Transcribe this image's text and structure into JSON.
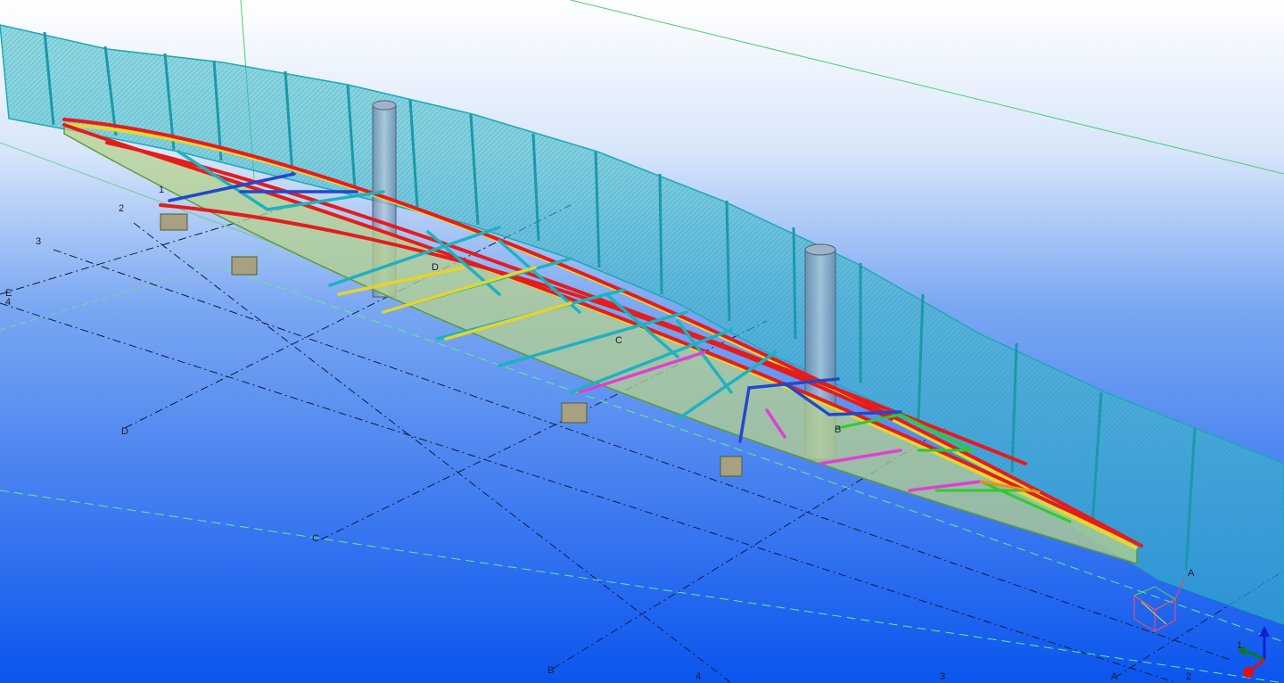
{
  "window": {
    "title": ""
  },
  "viewport": {
    "background": {
      "top": "#ffffff",
      "mid": "#5a8ff0",
      "bottom": "#0b55ee"
    },
    "colors": {
      "fence": "#29b8c8",
      "fence_fill": "#3cc2cc",
      "chord_red": "#e82020",
      "chord_yellow": "#e8d820",
      "member_teal": "#20b0c0",
      "member_blue": "#2050d0",
      "member_green": "#30d030",
      "member_magenta": "#e040d0",
      "deck_green": "#b8d890",
      "column": "#8aa0b8",
      "gridline": "#10204a"
    }
  },
  "grid": {
    "labels": [
      "1",
      "2",
      "3",
      "4",
      "E",
      "D",
      "C",
      "B",
      "A"
    ],
    "numbered_axes": [
      {
        "id": "1",
        "text": "1"
      },
      {
        "id": "2",
        "text": "2"
      },
      {
        "id": "3",
        "text": "3"
      },
      {
        "id": "4",
        "text": "4"
      },
      {
        "id": "E",
        "text": "E"
      },
      {
        "id": "D",
        "text": "D"
      },
      {
        "id": "C",
        "text": "C"
      },
      {
        "id": "B",
        "text": "B"
      },
      {
        "id": "A",
        "text": "A"
      }
    ]
  },
  "axis_gizmo": {
    "x": "x",
    "y": "y",
    "z": "z",
    "icon": "xyz-axis-icon"
  },
  "view_cube_icon": "view-cube-icon"
}
